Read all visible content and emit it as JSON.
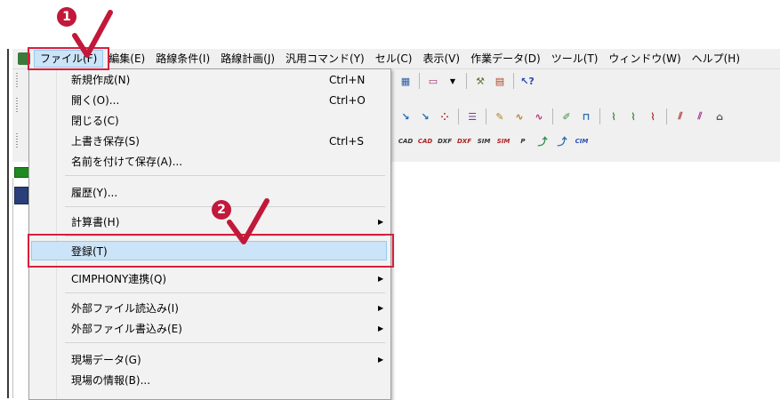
{
  "menubar": {
    "items": [
      "ファイル(F)",
      "編集(E)",
      "路線条件(I)",
      "路線計画(J)",
      "汎用コマンド(Y)",
      "セル(C)",
      "表示(V)",
      "作業データ(D)",
      "ツール(T)",
      "ウィンドウ(W)",
      "ヘルプ(H)"
    ]
  },
  "toolbar": {
    "row3_labels": [
      "CAD",
      "CAD",
      "DXF",
      "DXF",
      "SIM",
      "SIM",
      "P",
      "",
      "",
      "CIM"
    ]
  },
  "file_menu": {
    "items": [
      {
        "label": "新規作成(N)",
        "shortcut": "Ctrl+N"
      },
      {
        "label": "開く(O)...",
        "shortcut": "Ctrl+O"
      },
      {
        "label": "閉じる(C)",
        "shortcut": ""
      },
      {
        "label": "上書き保存(S)",
        "shortcut": "Ctrl+S"
      },
      {
        "label": "名前を付けて保存(A)...",
        "shortcut": ""
      },
      {
        "label": "履歴(Y)...",
        "shortcut": ""
      },
      {
        "label": "計算書(H)",
        "shortcut": ""
      },
      {
        "label": "登録(T)",
        "shortcut": ""
      },
      {
        "label": "CIMPHONY連携(Q)",
        "shortcut": ""
      },
      {
        "label": "外部ファイル読込み(I)",
        "shortcut": ""
      },
      {
        "label": "外部ファイル書込み(E)",
        "shortcut": ""
      },
      {
        "label": "現場データ(G)",
        "shortcut": ""
      },
      {
        "label": "現場の情報(B)...",
        "shortcut": ""
      }
    ]
  },
  "annotations": {
    "step1": "1",
    "step2": "2",
    "highlight_color": "#d6203e"
  }
}
